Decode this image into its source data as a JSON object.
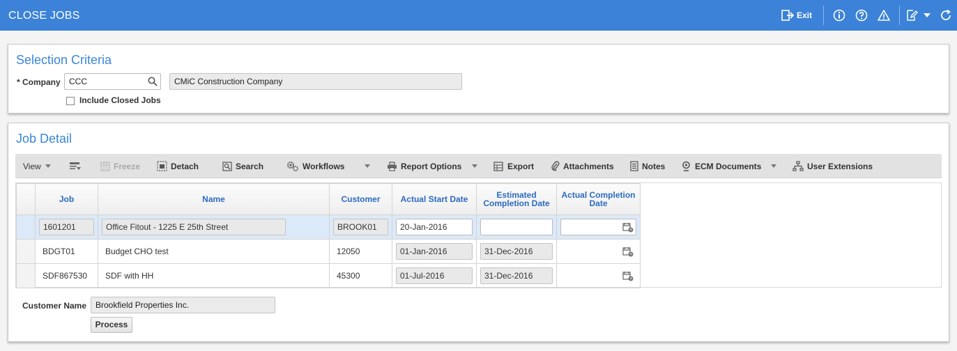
{
  "header": {
    "title": "CLOSE JOBS",
    "exit_label": "Exit",
    "accent_color": "#3b82d8"
  },
  "selection": {
    "title": "Selection Criteria",
    "company_label": "* Company",
    "company_value": "CCC",
    "company_name": "CMiC Construction Company",
    "include_closed_label": "Include Closed Jobs",
    "include_closed_checked": false
  },
  "job_detail": {
    "title": "Job Detail",
    "toolbar": {
      "view": "View",
      "freeze": "Freeze",
      "detach": "Detach",
      "search": "Search",
      "workflows": "Workflows",
      "report_options": "Report Options",
      "export": "Export",
      "attachments": "Attachments",
      "notes": "Notes",
      "ecm_documents": "ECM Documents",
      "user_extensions": "User Extensions"
    },
    "columns": {
      "job": "Job",
      "name": "Name",
      "customer": "Customer",
      "actual_start": "Actual Start Date",
      "estimated_completion": "Estimated Completion Date",
      "actual_completion": "Actual Completion Date"
    },
    "rows": [
      {
        "job": "1601201",
        "name": "Office Fitout - 1225 E 25th Street",
        "customer": "BROOK01",
        "actual_start": "20-Jan-2016",
        "estimated_completion": "",
        "actual_completion": ""
      },
      {
        "job": "BDGT01",
        "name": "Budget CHO test",
        "customer": "12050",
        "actual_start": "01-Jan-2016",
        "estimated_completion": "31-Dec-2016",
        "actual_completion": ""
      },
      {
        "job": "SDF867530",
        "name": "SDF with HH",
        "customer": "45300",
        "actual_start": "01-Jul-2016",
        "estimated_completion": "31-Dec-2016",
        "actual_completion": ""
      }
    ],
    "customer_name_label": "Customer Name",
    "customer_name_value": "Brookfield Properties Inc.",
    "process_label": "Process"
  }
}
